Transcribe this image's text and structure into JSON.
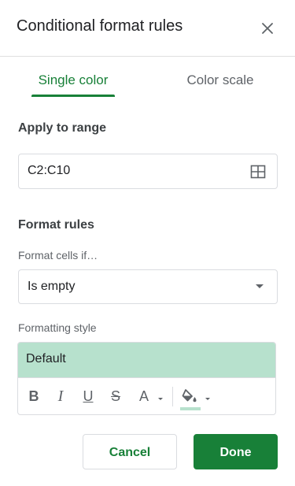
{
  "header": {
    "title": "Conditional format rules",
    "close_icon": "close-icon"
  },
  "tabs": [
    {
      "label": "Single color",
      "active": true
    },
    {
      "label": "Color scale",
      "active": false
    }
  ],
  "apply_range": {
    "label": "Apply to range",
    "value": "C2:C10",
    "icon": "grid-icon"
  },
  "format_rules": {
    "label": "Format rules",
    "cells_if_label": "Format cells if…",
    "condition": "Is empty"
  },
  "formatting_style": {
    "label": "Formatting style",
    "preset": "Default",
    "fill_color": "#b7e1cd",
    "toolbar": {
      "bold": "B",
      "italic": "I",
      "underline": "U",
      "strikethrough": "S",
      "text_color": "A"
    }
  },
  "buttons": {
    "cancel": "Cancel",
    "done": "Done"
  },
  "colors": {
    "accent": "#188038",
    "border": "#dadce0",
    "text_secondary": "#5f6368"
  }
}
